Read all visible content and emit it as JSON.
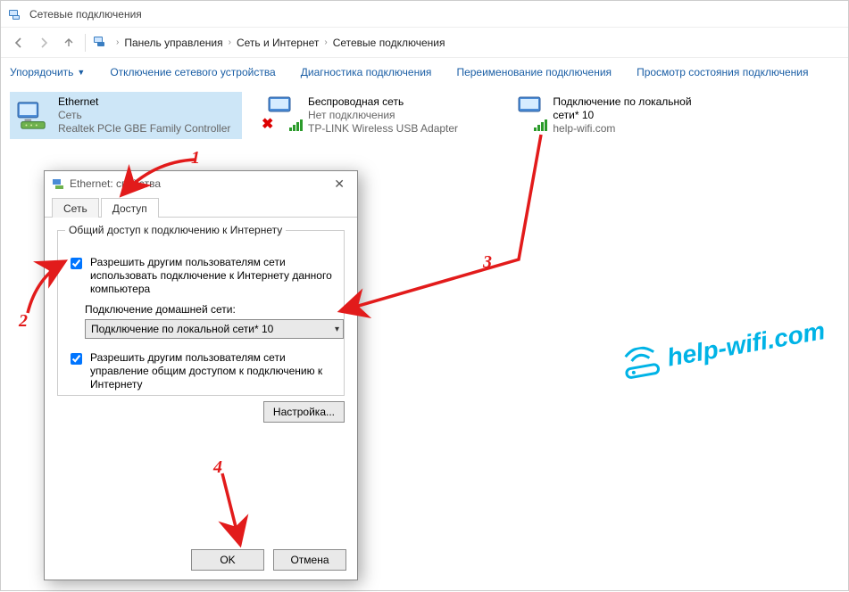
{
  "window": {
    "title": "Сетевые подключения"
  },
  "breadcrumbs": {
    "item1": "Панель управления",
    "item2": "Сеть и Интернет",
    "item3": "Сетевые подключения"
  },
  "cmdbar": {
    "organize": "Упорядочить",
    "disable": "Отключение сетевого устройства",
    "diagnose": "Диагностика подключения",
    "rename": "Переименование подключения",
    "status": "Просмотр состояния подключения"
  },
  "connections": {
    "eth": {
      "name": "Ethernet",
      "line2": "Сеть",
      "line3": "Realtek PCIe GBE Family Controller"
    },
    "wlan": {
      "name": "Беспроводная сеть",
      "line2": "Нет подключения",
      "line3": "TP-LINK Wireless USB Adapter"
    },
    "local": {
      "name": "Подключение по локальной сети* 10",
      "line3": "help-wifi.com"
    }
  },
  "dialog": {
    "title": "Ethernet: свойства",
    "tab_network": "Сеть",
    "tab_sharing": "Доступ",
    "group_legend": "Общий доступ к подключению к Интернету",
    "chk1": "Разрешить другим пользователям сети использовать подключение к Интернету данного компьютера",
    "home_label": "Подключение домашней сети:",
    "combo_value": "Подключение по локальной сети* 10",
    "chk2": "Разрешить другим пользователям сети управление общим доступом к подключению к Интернету",
    "settings_btn": "Настройка...",
    "ok": "OK",
    "cancel": "Отмена"
  },
  "annotations": {
    "n1": "1",
    "n2": "2",
    "n3": "3",
    "n4": "4",
    "watermark": "help-wifi.com"
  }
}
